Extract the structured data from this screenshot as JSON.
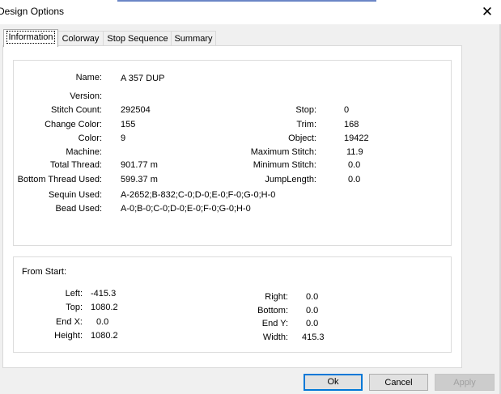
{
  "window": {
    "title": "Design Options",
    "close_glyph": "✕"
  },
  "tabs": [
    "Information",
    "Colorway",
    "Stop Sequence",
    "Summary"
  ],
  "info": {
    "name": {
      "label": "Name:",
      "value": "A 357 DUP"
    },
    "version": {
      "label": "Version:",
      "value": ""
    },
    "stitch_count": {
      "label": "Stitch Count:",
      "value": "292504"
    },
    "change_color": {
      "label": "Change Color:",
      "value": "155"
    },
    "color": {
      "label": "Color:",
      "value": "9"
    },
    "machine": {
      "label": "Machine:",
      "value": ""
    },
    "total_thread": {
      "label": "Total Thread:",
      "value": "901.77 m"
    },
    "bottom_thread": {
      "label": "Bottom Thread Used:",
      "value": "599.37 m"
    },
    "sequin_used": {
      "label": "Sequin Used:",
      "value": "A-2652;B-832;C-0;D-0;E-0;F-0;G-0;H-0"
    },
    "bead_used": {
      "label": "Bead Used:",
      "value": "A-0;B-0;C-0;D-0;E-0;F-0;G-0;H-0"
    },
    "stop": {
      "label": "Stop:",
      "value": "0"
    },
    "trim": {
      "label": "Trim:",
      "value": "168"
    },
    "object": {
      "label": "Object:",
      "value": "19422"
    },
    "max_stitch": {
      "label": "Maximum Stitch:",
      "value": "11.9"
    },
    "min_stitch": {
      "label": "Minimum Stitch:",
      "value": "0.0"
    },
    "jump_length": {
      "label": "JumpLength:",
      "value": "0.0"
    }
  },
  "from_start": {
    "heading": "From Start:",
    "left": {
      "label": "Left:",
      "value": "-415.3"
    },
    "top": {
      "label": "Top:",
      "value": "1080.2"
    },
    "end_x": {
      "label": "End X:",
      "value": "0.0"
    },
    "height": {
      "label": "Height:",
      "value": "1080.2"
    },
    "right": {
      "label": "Right:",
      "value": "0.0"
    },
    "bottom": {
      "label": "Bottom:",
      "value": "0.0"
    },
    "end_y": {
      "label": "End Y:",
      "value": "0.0"
    },
    "width": {
      "label": "Width:",
      "value": "415.3"
    }
  },
  "buttons": {
    "ok": "Ok",
    "cancel": "Cancel",
    "apply": "Apply"
  }
}
